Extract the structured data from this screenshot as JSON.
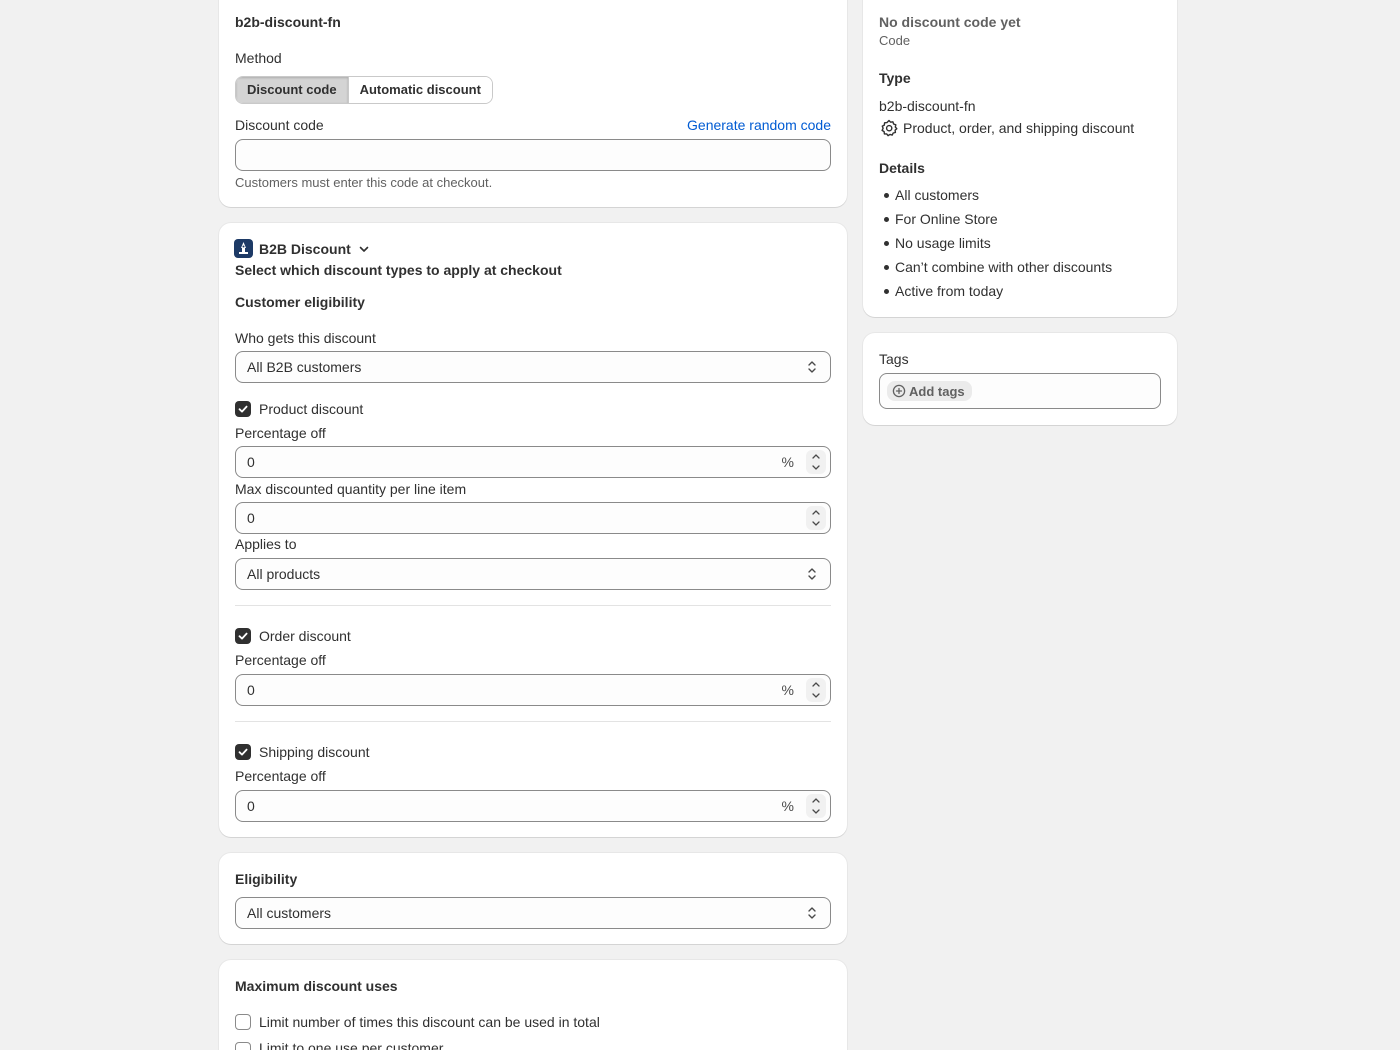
{
  "method_card": {
    "title": "b2b-discount-fn",
    "method_label": "Method",
    "method_options": [
      "Discount code",
      "Automatic discount"
    ],
    "selected_method": "Discount code",
    "code_label": "Discount code",
    "generate_link": "Generate random code",
    "code_value": "",
    "help_text": "Customers must enter this code at checkout."
  },
  "b2b_card": {
    "app_name": "B2B Discount",
    "subtitle": "Select which discount types to apply at checkout",
    "eligibility_heading": "Customer eligibility",
    "who_label": "Who gets this discount",
    "who_value": "All B2B customers",
    "product": {
      "checkbox_label": "Product discount",
      "checked": true,
      "pct_label": "Percentage off",
      "pct_value": "0",
      "pct_suffix": "%",
      "max_label": "Max discounted quantity per line item",
      "max_value": "0",
      "applies_label": "Applies to",
      "applies_value": "All products"
    },
    "order": {
      "checkbox_label": "Order discount",
      "checked": true,
      "pct_label": "Percentage off",
      "pct_value": "0",
      "pct_suffix": "%"
    },
    "shipping": {
      "checkbox_label": "Shipping discount",
      "checked": true,
      "pct_label": "Percentage off",
      "pct_value": "0",
      "pct_suffix": "%"
    }
  },
  "eligibility_card": {
    "title": "Eligibility",
    "value": "All customers"
  },
  "max_uses_card": {
    "title": "Maximum discount uses",
    "options": [
      {
        "label": "Limit number of times this discount can be used in total",
        "checked": false
      },
      {
        "label": "Limit to one use per customer",
        "checked": false
      }
    ]
  },
  "summary_card": {
    "code_title": "No discount code yet",
    "code_sub": "Code",
    "type_heading": "Type",
    "type_name": "b2b-discount-fn",
    "type_desc": "Product, order, and shipping discount",
    "details_heading": "Details",
    "details": [
      "All customers",
      "For Online Store",
      "No usage limits",
      "Can’t combine with other discounts",
      "Active from today"
    ]
  },
  "tags_card": {
    "title": "Tags",
    "add_label": "Add tags"
  },
  "colors": {
    "background": "#f1f1f1",
    "card": "#ffffff",
    "link": "#005bd3",
    "checkbox_checked": "#303030",
    "app_icon": "#1d3a66"
  }
}
